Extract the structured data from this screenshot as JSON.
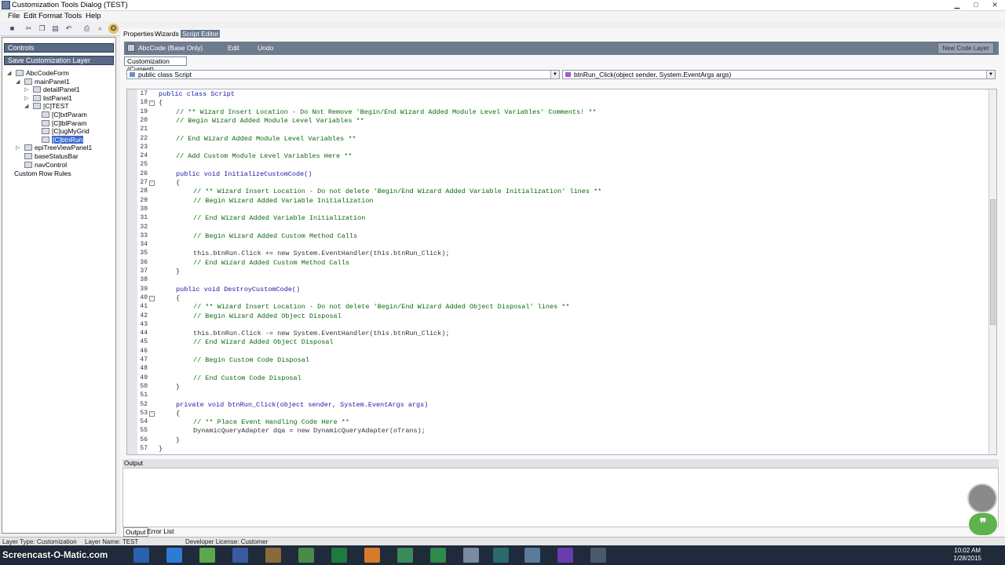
{
  "window": {
    "title": "Customization Tools Dialog  (TEST)"
  },
  "menu": [
    "File",
    "Edit",
    "Format",
    "Tools",
    "Help"
  ],
  "left": {
    "header": "Controls",
    "subheader": "Save Customization Layer",
    "tree": [
      {
        "label": "AbcCodeForm",
        "indent": 0,
        "exp": "◢"
      },
      {
        "label": "mainPanel1",
        "indent": 1,
        "exp": "◢"
      },
      {
        "label": "detailPanel1",
        "indent": 2,
        "exp": "▷"
      },
      {
        "label": "listPanel1",
        "indent": 2,
        "exp": "▷"
      },
      {
        "label": "[C]TEST",
        "indent": 2,
        "exp": "◢"
      },
      {
        "label": "[C]txtParam",
        "indent": 3,
        "exp": ""
      },
      {
        "label": "[C]lblParam",
        "indent": 3,
        "exp": ""
      },
      {
        "label": "[C]ugMyGrid",
        "indent": 3,
        "exp": ""
      },
      {
        "label": "[C]btnRun",
        "indent": 3,
        "exp": "",
        "selected": true
      },
      {
        "label": "epiTreeViewPanel1",
        "indent": 1,
        "exp": "▷"
      },
      {
        "label": "baseStatusBar",
        "indent": 1,
        "exp": ""
      },
      {
        "label": "navControl",
        "indent": 1,
        "exp": ""
      }
    ],
    "extra": "Custom Row Rules"
  },
  "tabs": [
    "Properties",
    "Wizards",
    "Script Editor"
  ],
  "strip": {
    "b1": "AbcCode (Base Only)",
    "b2": "Edit",
    "b3": "Undo",
    "new_layer": "New Code Layer"
  },
  "customization_tab": "Customization (Current)",
  "combo_left": "public class Script",
  "combo_right": "btnRun_Click(object sender, System.EventArgs args)",
  "code": [
    {
      "n": "17",
      "i": 1,
      "t": "public class Script",
      "k": 1
    },
    {
      "n": "18",
      "i": 1,
      "t": "{",
      "f": "-"
    },
    {
      "n": "19",
      "i": 2,
      "t": "// ** Wizard Insert Location - Do Not Remove 'Begin/End Wizard Added Module Level Variables' Comments! **",
      "c": 1
    },
    {
      "n": "20",
      "i": 2,
      "t": "// Begin Wizard Added Module Level Variables **",
      "c": 1
    },
    {
      "n": "21",
      "i": 2,
      "t": ""
    },
    {
      "n": "22",
      "i": 2,
      "t": "// End Wizard Added Module Level Variables **",
      "c": 1
    },
    {
      "n": "23",
      "i": 2,
      "t": ""
    },
    {
      "n": "24",
      "i": 2,
      "t": "// Add Custom Module Level Variables Here **",
      "c": 1
    },
    {
      "n": "25",
      "i": 2,
      "t": ""
    },
    {
      "n": "26",
      "i": 2,
      "t": "public void InitializeCustomCode()",
      "k": 1
    },
    {
      "n": "27",
      "i": 2,
      "t": "{",
      "f": "-"
    },
    {
      "n": "28",
      "i": 3,
      "t": "// ** Wizard Insert Location - Do not delete 'Begin/End Wizard Added Variable Initialization' lines **",
      "c": 1
    },
    {
      "n": "29",
      "i": 3,
      "t": "// Begin Wizard Added Variable Initialization",
      "c": 1
    },
    {
      "n": "30",
      "i": 3,
      "t": ""
    },
    {
      "n": "31",
      "i": 3,
      "t": "// End Wizard Added Variable Initialization",
      "c": 1
    },
    {
      "n": "32",
      "i": 3,
      "t": ""
    },
    {
      "n": "33",
      "i": 3,
      "t": "// Begin Wizard Added Custom Method Calls",
      "c": 1
    },
    {
      "n": "34",
      "i": 3,
      "t": ""
    },
    {
      "n": "35",
      "i": 3,
      "t": "this.btnRun.Click += new System.EventHandler(this.btnRun_Click);"
    },
    {
      "n": "36",
      "i": 3,
      "t": "// End Wizard Added Custom Method Calls",
      "c": 1
    },
    {
      "n": "37",
      "i": 2,
      "t": "}"
    },
    {
      "n": "38",
      "i": 2,
      "t": ""
    },
    {
      "n": "39",
      "i": 2,
      "t": "public void DestroyCustomCode()",
      "k": 1
    },
    {
      "n": "40",
      "i": 2,
      "t": "{",
      "f": "-"
    },
    {
      "n": "41",
      "i": 3,
      "t": "// ** Wizard Insert Location - Do not delete 'Begin/End Wizard Added Object Disposal' lines **",
      "c": 1
    },
    {
      "n": "42",
      "i": 3,
      "t": "// Begin Wizard Added Object Disposal",
      "c": 1
    },
    {
      "n": "43",
      "i": 3,
      "t": ""
    },
    {
      "n": "44",
      "i": 3,
      "t": "this.btnRun.Click -= new System.EventHandler(this.btnRun_Click);"
    },
    {
      "n": "45",
      "i": 3,
      "t": "// End Wizard Added Object Disposal",
      "c": 1
    },
    {
      "n": "46",
      "i": 3,
      "t": ""
    },
    {
      "n": "47",
      "i": 3,
      "t": "// Begin Custom Code Disposal",
      "c": 1
    },
    {
      "n": "48",
      "i": 3,
      "t": ""
    },
    {
      "n": "49",
      "i": 3,
      "t": "// End Custom Code Disposal",
      "c": 1
    },
    {
      "n": "50",
      "i": 2,
      "t": "}"
    },
    {
      "n": "51",
      "i": 2,
      "t": ""
    },
    {
      "n": "52",
      "i": 2,
      "t": "private void btnRun_Click(object sender, System.EventArgs args)",
      "k": 1
    },
    {
      "n": "53",
      "i": 2,
      "t": "{",
      "f": "-"
    },
    {
      "n": "54",
      "i": 3,
      "t": "// ** Place Event Handling Code Here **",
      "c": 1
    },
    {
      "n": "55",
      "i": 3,
      "t": "DynamicQueryAdapter dqa = new DynamicQueryAdapter(oTrans);"
    },
    {
      "n": "56",
      "i": 2,
      "t": "}"
    },
    {
      "n": "57",
      "i": 1,
      "t": "}"
    }
  ],
  "output": {
    "header": "Output",
    "tabs": [
      "Output",
      "Error List"
    ]
  },
  "status": {
    "a": "Layer Type: Customization",
    "b": "Layer Name: TEST",
    "c": "Developer License: Customer"
  },
  "taskbar": {
    "watermark": "Screencast-O-Matic.com",
    "time": "10:02 AM",
    "date": "1/28/2015"
  }
}
